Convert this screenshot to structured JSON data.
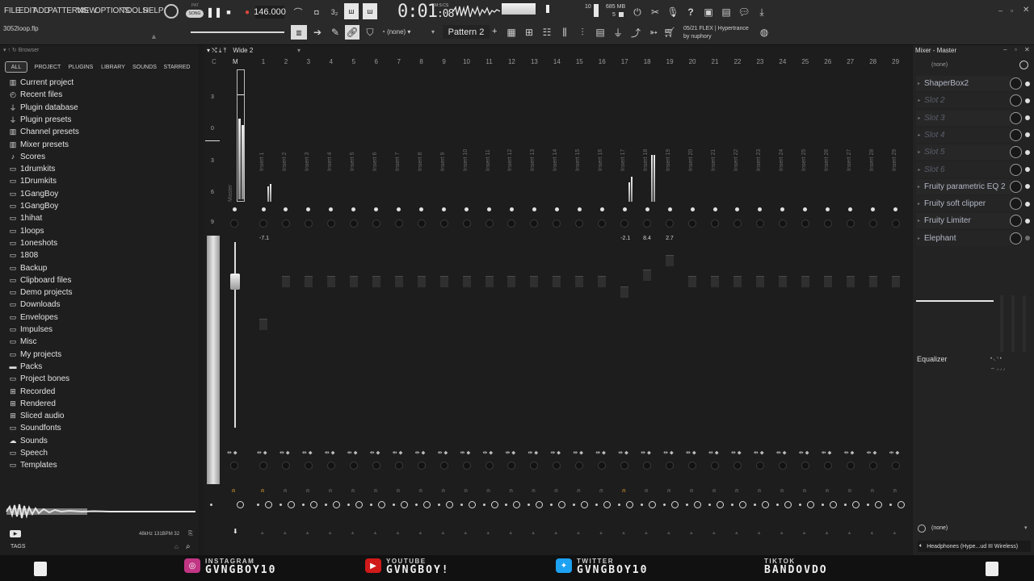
{
  "menu": [
    "FILE",
    "EDIT",
    "ADD",
    "PATTERNS",
    "VIEW",
    "OPTIONS",
    "TOOLS",
    "HELP"
  ],
  "transport": {
    "mode": "SONG",
    "pat_label": "PAT",
    "tempo": "146.000",
    "time": "0:01",
    "time_small": ":08",
    "time_label": "M:S:CS"
  },
  "cpu": {
    "ram": "685 MB",
    "voices": "5",
    "cpu_num": "10"
  },
  "pattern": {
    "snap": "(none)",
    "name": "Pattern 2",
    "plus": "+"
  },
  "news": {
    "line1": "05/21  FLEX | Hypertrance",
    "line2": "by nuphory"
  },
  "project_file": "3052loop.flp",
  "browser": {
    "title": "Browser",
    "tabs": [
      "ALL",
      "PROJECT",
      "PLUGINS",
      "LIBRARY",
      "SOUNDS",
      "STARRED"
    ],
    "items": [
      {
        "label": "Current project",
        "icon": "project"
      },
      {
        "label": "Recent files",
        "icon": "folder-clock"
      },
      {
        "label": "Plugin database",
        "icon": "plug"
      },
      {
        "label": "Plugin presets",
        "icon": "plug"
      },
      {
        "label": "Channel presets",
        "icon": "channel"
      },
      {
        "label": "Mixer presets",
        "icon": "mixer"
      },
      {
        "label": "Scores",
        "icon": "note"
      },
      {
        "label": "1drumkits",
        "icon": "folder"
      },
      {
        "label": "1Drumkits",
        "icon": "folder"
      },
      {
        "label": "1GangBoy",
        "icon": "folder"
      },
      {
        "label": "1GangBoy",
        "icon": "folder"
      },
      {
        "label": "1hihat",
        "icon": "folder"
      },
      {
        "label": "1loops",
        "icon": "folder"
      },
      {
        "label": "1oneshots",
        "icon": "folder"
      },
      {
        "label": "1808",
        "icon": "folder"
      },
      {
        "label": "Backup",
        "icon": "folder"
      },
      {
        "label": "Clipboard files",
        "icon": "folder"
      },
      {
        "label": "Demo projects",
        "icon": "folder"
      },
      {
        "label": "Downloads",
        "icon": "folder"
      },
      {
        "label": "Envelopes",
        "icon": "folder"
      },
      {
        "label": "Impulses",
        "icon": "folder"
      },
      {
        "label": "Misc",
        "icon": "folder"
      },
      {
        "label": "My projects",
        "icon": "folder"
      },
      {
        "label": "Packs",
        "icon": "folder-solid"
      },
      {
        "label": "Project bones",
        "icon": "folder"
      },
      {
        "label": "Recorded",
        "icon": "plus"
      },
      {
        "label": "Rendered",
        "icon": "plus"
      },
      {
        "label": "Sliced audio",
        "icon": "plus"
      },
      {
        "label": "Soundfonts",
        "icon": "folder"
      },
      {
        "label": "Sounds",
        "icon": "cloud"
      },
      {
        "label": "Speech",
        "icon": "folder"
      },
      {
        "label": "Templates",
        "icon": "folder"
      }
    ],
    "tags_label": "TAGS",
    "sample_info": "48kHz 131BPM 32"
  },
  "mixer": {
    "layout_name": "Wide 2",
    "header_labels": [
      "C",
      "M"
    ],
    "master_label": "Master",
    "scale": [
      "3",
      "0",
      "3",
      "6",
      "9"
    ],
    "channels": [
      "1",
      "2",
      "3",
      "4",
      "5",
      "6",
      "7",
      "8",
      "9",
      "10",
      "11",
      "12",
      "13",
      "14",
      "15",
      "16",
      "17",
      "18",
      "19",
      "20",
      "21",
      "22",
      "23",
      "24",
      "25",
      "26",
      "27",
      "28",
      "29"
    ],
    "insert_names": [
      "Insert 1",
      "Insert 2",
      "Insert 3",
      "Insert 4",
      "Insert 5",
      "Insert 6",
      "Insert 7",
      "Insert 8",
      "Insert 9",
      "Insert 10",
      "Insert 11",
      "Insert 12",
      "Insert 13",
      "Insert 14",
      "Insert 15",
      "Insert 16",
      "Insert 17",
      "Insert 18",
      "Insert 19",
      "Insert 20",
      "Insert 21",
      "Insert 22",
      "Insert 23",
      "Insert 24",
      "Insert 25",
      "Insert 26",
      "Insert 27",
      "Insert 28",
      "Insert 29"
    ],
    "peak_values": {
      "ch1": "-7.1",
      "ch17": "-2.1",
      "ch18": "8.4",
      "ch19": "2.7"
    }
  },
  "mixer_panel": {
    "title": "Mixer - Master",
    "input": "(none)",
    "slots": [
      {
        "label": "ShaperBox2",
        "active": true
      },
      {
        "label": "Slot 2",
        "active": false
      },
      {
        "label": "Slot 3",
        "active": false
      },
      {
        "label": "Slot 4",
        "active": false
      },
      {
        "label": "Slot 5",
        "active": false
      },
      {
        "label": "Slot 6",
        "active": false
      },
      {
        "label": "Fruity parametric EQ 2",
        "active": true
      },
      {
        "label": "Fruity soft clipper",
        "active": true
      },
      {
        "label": "Fruity Limiter",
        "active": true
      },
      {
        "label": "Elephant",
        "active": true
      }
    ],
    "equalizer_label": "Equalizer",
    "output": "(none)",
    "device": "Headphones (Hype...ud III Wireless)"
  },
  "social": [
    {
      "platform": "INSTAGRAM",
      "handle": "GVNGBOY10",
      "color": "#c13584",
      "icon": "instagram-icon"
    },
    {
      "platform": "YOUTUBE",
      "handle": "GVNGBOY!",
      "color": "#d11a1a",
      "icon": "youtube-icon"
    },
    {
      "platform": "TWITTER",
      "handle": "GVNGBOY10",
      "color": "#1da1f2",
      "icon": "twitter-icon"
    },
    {
      "platform": "TIKTOK",
      "handle": "BANDOVDO",
      "color": "#111111",
      "icon": "tiktok-icon"
    }
  ]
}
